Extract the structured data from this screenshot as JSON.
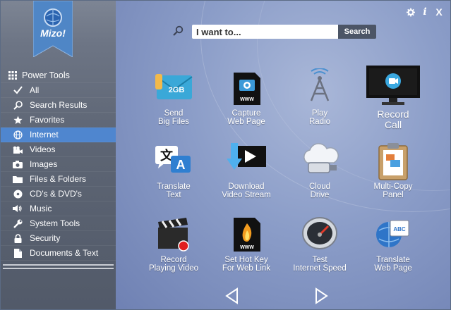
{
  "app": {
    "logo_text": "Mizo!"
  },
  "toolbar": {
    "settings_icon": "gear-icon",
    "info_label": "i",
    "close_label": "X"
  },
  "search": {
    "placeholder": "I want to...",
    "button_label": "Search"
  },
  "sidebar": {
    "items": [
      {
        "label": "Power Tools",
        "icon": "grid-icon"
      },
      {
        "label": "All",
        "icon": "check-icon"
      },
      {
        "label": "Search Results",
        "icon": "search-icon"
      },
      {
        "label": "Favorites",
        "icon": "star-icon"
      },
      {
        "label": "Internet",
        "icon": "globe-icon",
        "active": true
      },
      {
        "label": "Videos",
        "icon": "camera-icon"
      },
      {
        "label": "Images",
        "icon": "photo-icon"
      },
      {
        "label": "Files & Folders",
        "icon": "folder-icon"
      },
      {
        "label": "CD's & DVD's",
        "icon": "disc-icon"
      },
      {
        "label": "Music",
        "icon": "speaker-icon"
      },
      {
        "label": "System Tools",
        "icon": "wrench-icon"
      },
      {
        "label": "Security",
        "icon": "lock-icon"
      },
      {
        "label": "Documents & Text",
        "icon": "document-icon"
      }
    ]
  },
  "tiles": [
    {
      "label": "Send\nBig Files",
      "icon": "envelope-icon",
      "badge": "2GB"
    },
    {
      "label": "Capture\nWeb Page",
      "icon": "camera-www-icon",
      "badge": "WWW"
    },
    {
      "label": "Play\nRadio",
      "icon": "radio-tower-icon"
    },
    {
      "label": "Record\nCall",
      "icon": "monitor-call-icon"
    },
    {
      "label": "Translate\nText",
      "icon": "translate-icon"
    },
    {
      "label": "Download\nVideo Stream",
      "icon": "download-video-icon"
    },
    {
      "label": "Cloud\nDrive",
      "icon": "cloud-drive-icon"
    },
    {
      "label": "Multi-Copy\nPanel",
      "icon": "clipboard-icon"
    },
    {
      "label": "Record\nPlaying Video",
      "icon": "clapperboard-icon"
    },
    {
      "label": "Set Hot Key\nFor Web Link",
      "icon": "hotkey-www-icon",
      "badge": "WWW"
    },
    {
      "label": "Test\nInternet Speed",
      "icon": "speedometer-icon"
    },
    {
      "label": "Translate\nWeb Page",
      "icon": "translate-web-icon",
      "badge": "ABC"
    }
  ],
  "colors": {
    "active": "#4f86cf",
    "sidebar": "#5d6574",
    "main_bg": "#8b9dc8"
  }
}
